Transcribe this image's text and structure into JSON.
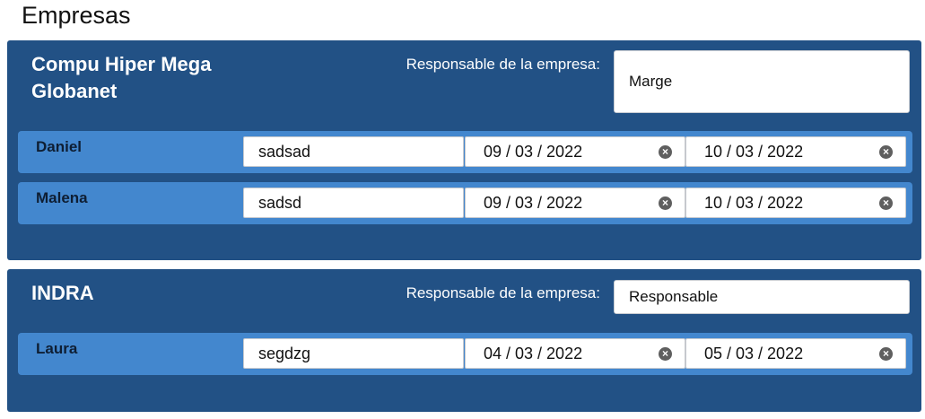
{
  "page": {
    "title": "Empresas"
  },
  "companies": [
    {
      "name": "Compu Hiper Mega Globanet",
      "responsable_label": "Responsable de la empresa:",
      "responsable_value": "Marge",
      "employees": [
        {
          "name": "Daniel",
          "task": "sadsad",
          "start": "09 / 03 / 2022",
          "end": "10 / 03 / 2022"
        },
        {
          "name": "Malena",
          "task": "sadsd",
          "start": "09 / 03 / 2022",
          "end": "10 / 03 / 2022"
        }
      ]
    },
    {
      "name": "INDRA",
      "responsable_label": "Responsable de la empresa:",
      "responsable_value": "Responsable",
      "employees": [
        {
          "name": "Laura",
          "task": "segdzg",
          "start": "04 / 03 / 2022",
          "end": "05 / 03 / 2022"
        }
      ]
    }
  ],
  "icons": {
    "clear": "clear-circle-icon"
  },
  "colors": {
    "panel": "#225185",
    "row": "#4387ce"
  }
}
